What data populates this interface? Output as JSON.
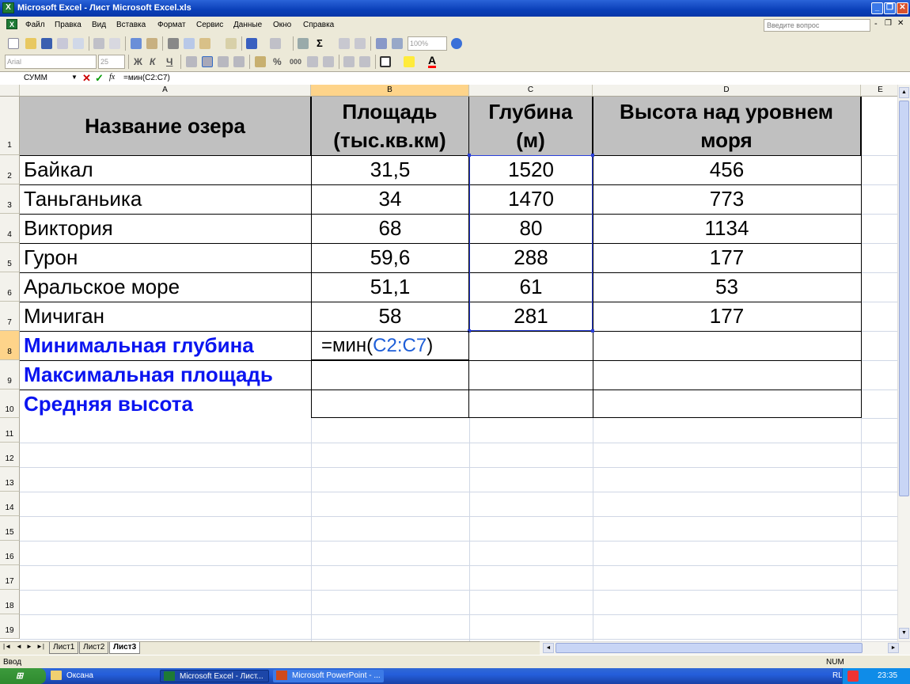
{
  "window": {
    "title": "Microsoft Excel - Лист Microsoft Excel.xls"
  },
  "menu": {
    "items": [
      "Файл",
      "Правка",
      "Вид",
      "Вставка",
      "Формат",
      "Сервис",
      "Данные",
      "Окно",
      "Справка"
    ],
    "help_placeholder": "Введите вопрос"
  },
  "toolbar": {
    "zoom": "100%",
    "font": "Arial",
    "font_size": "25"
  },
  "formula_bar": {
    "name_box": "СУММ",
    "fx": "fx",
    "formula": "=мин(C2:C7)"
  },
  "columns": [
    "A",
    "B",
    "C",
    "D",
    "E"
  ],
  "rows": [
    "1",
    "2",
    "3",
    "4",
    "5",
    "6",
    "7",
    "8",
    "9",
    "10",
    "11",
    "12",
    "13",
    "14",
    "15",
    "16",
    "17",
    "18",
    "19"
  ],
  "table": {
    "headers": [
      "Название озера",
      "Площадь (тыс.кв.км)",
      "Глубина (м)",
      "Высота над уровнем моря"
    ],
    "data": [
      [
        "Байкал",
        "31,5",
        "1520",
        "456"
      ],
      [
        "Таньганьика",
        "34",
        "1470",
        "773"
      ],
      [
        "Виктория",
        "68",
        "80",
        "1134"
      ],
      [
        "Гурон",
        "59,6",
        "288",
        "177"
      ],
      [
        "Аральское море",
        "51,1",
        "61",
        "53"
      ],
      [
        "Мичиган",
        "58",
        "281",
        "177"
      ]
    ],
    "summary_labels": [
      "Минимальная глубина",
      "Максимальная площадь",
      "Средняя высота"
    ],
    "formula_prefix": "=мин(",
    "formula_range": "C2:C7",
    "formula_suffix": ")"
  },
  "sheets": [
    "Лист1",
    "Лист2",
    "Лист3"
  ],
  "status": {
    "mode": "Ввод",
    "num": "NUM"
  },
  "taskbar": {
    "items": [
      "Оксана",
      "Microsoft Excel - Лист...",
      "Microsoft PowerPoint - ..."
    ],
    "lang": "RL",
    "clock": "23:35"
  }
}
